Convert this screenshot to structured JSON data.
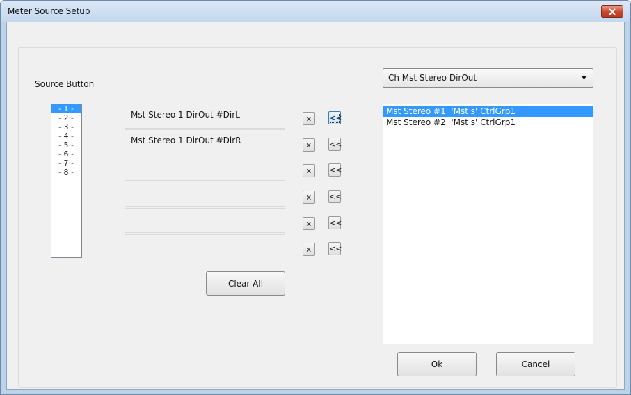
{
  "window": {
    "title": "Meter Source Setup"
  },
  "source_section": {
    "label": "Source Button",
    "items": [
      "- 1 -",
      "- 2 -",
      "- 3 -",
      "- 4 -",
      "- 5 -",
      "- 6 -",
      "- 7 -",
      "- 8 -"
    ],
    "selected_index": 0
  },
  "slots": [
    {
      "text": "Mst Stereo 1 DirOut #DirL"
    },
    {
      "text": "Mst Stereo 1 DirOut #DirR"
    },
    {
      "text": ""
    },
    {
      "text": ""
    },
    {
      "text": ""
    },
    {
      "text": ""
    }
  ],
  "slot_buttons": {
    "remove_label": "x",
    "assign_label": "<<"
  },
  "clear_all_label": "Clear All",
  "channel_type": {
    "selected": "Ch Mst Stereo DirOut"
  },
  "channel_list": {
    "items": [
      "Mst Stereo #1  'Mst s' CtrlGrp1",
      "Mst Stereo #2  'Mst s' CtrlGrp1"
    ],
    "selected_index": 0
  },
  "buttons": {
    "ok": "Ok",
    "cancel": "Cancel"
  },
  "colors": {
    "selection": "#3399ff",
    "close_button": "#c8452c"
  }
}
